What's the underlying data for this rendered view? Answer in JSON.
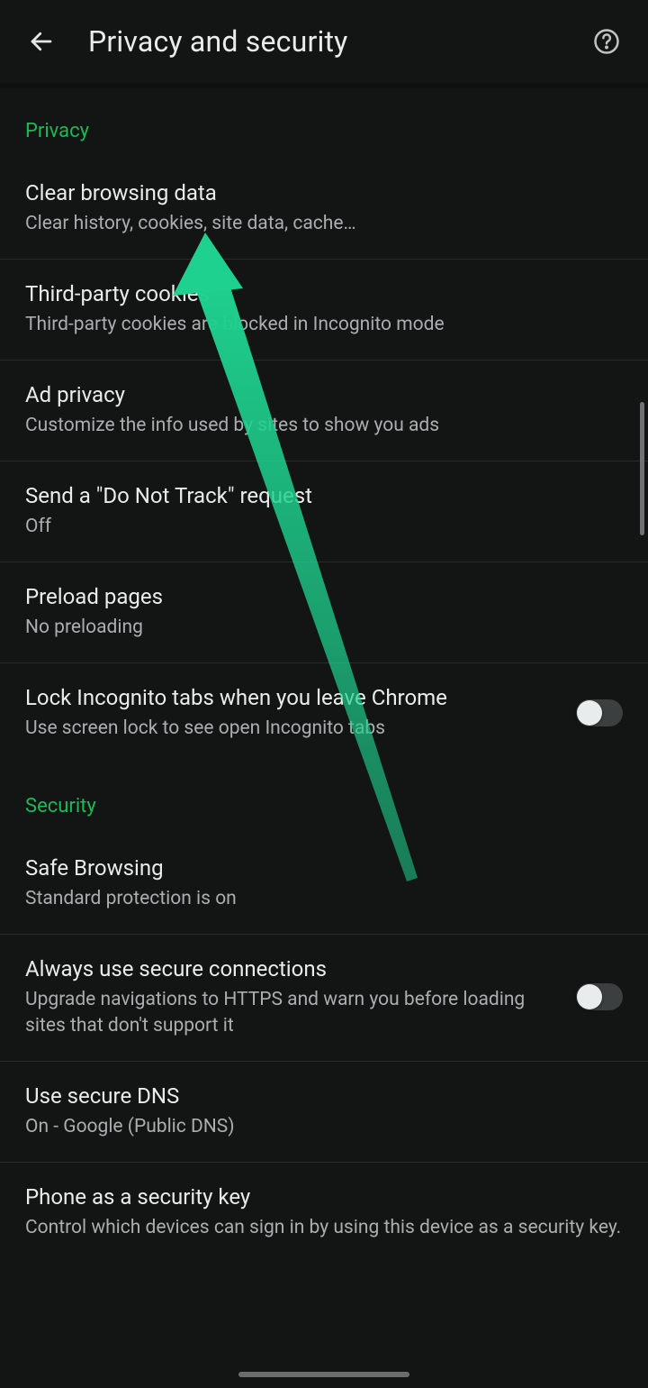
{
  "header": {
    "title": "Privacy and security"
  },
  "sections": {
    "privacy": {
      "header": "Privacy",
      "items": [
        {
          "title": "Clear browsing data",
          "sub": "Clear history, cookies, site data, cache…"
        },
        {
          "title": "Third-party cookies",
          "sub": "Third-party cookies are blocked in Incognito mode"
        },
        {
          "title": "Ad privacy",
          "sub": "Customize the info used by sites to show you ads"
        },
        {
          "title": "Send a \"Do Not Track\" request",
          "sub": "Off"
        },
        {
          "title": "Preload pages",
          "sub": "No preloading"
        },
        {
          "title": "Lock Incognito tabs when you leave Chrome",
          "sub": "Use screen lock to see open Incognito tabs",
          "switch": "off"
        }
      ]
    },
    "security": {
      "header": "Security",
      "items": [
        {
          "title": "Safe Browsing",
          "sub": "Standard protection is on"
        },
        {
          "title": "Always use secure connections",
          "sub": "Upgrade navigations to HTTPS and warn you before loading sites that don't support it",
          "switch": "off"
        },
        {
          "title": "Use secure DNS",
          "sub": "On - Google (Public DNS)"
        },
        {
          "title": "Phone as a security key",
          "sub": "Control which devices can sign in by using this device as a security key."
        }
      ]
    }
  },
  "annotation": {
    "kind": "arrow",
    "color": "#1ed18e"
  }
}
